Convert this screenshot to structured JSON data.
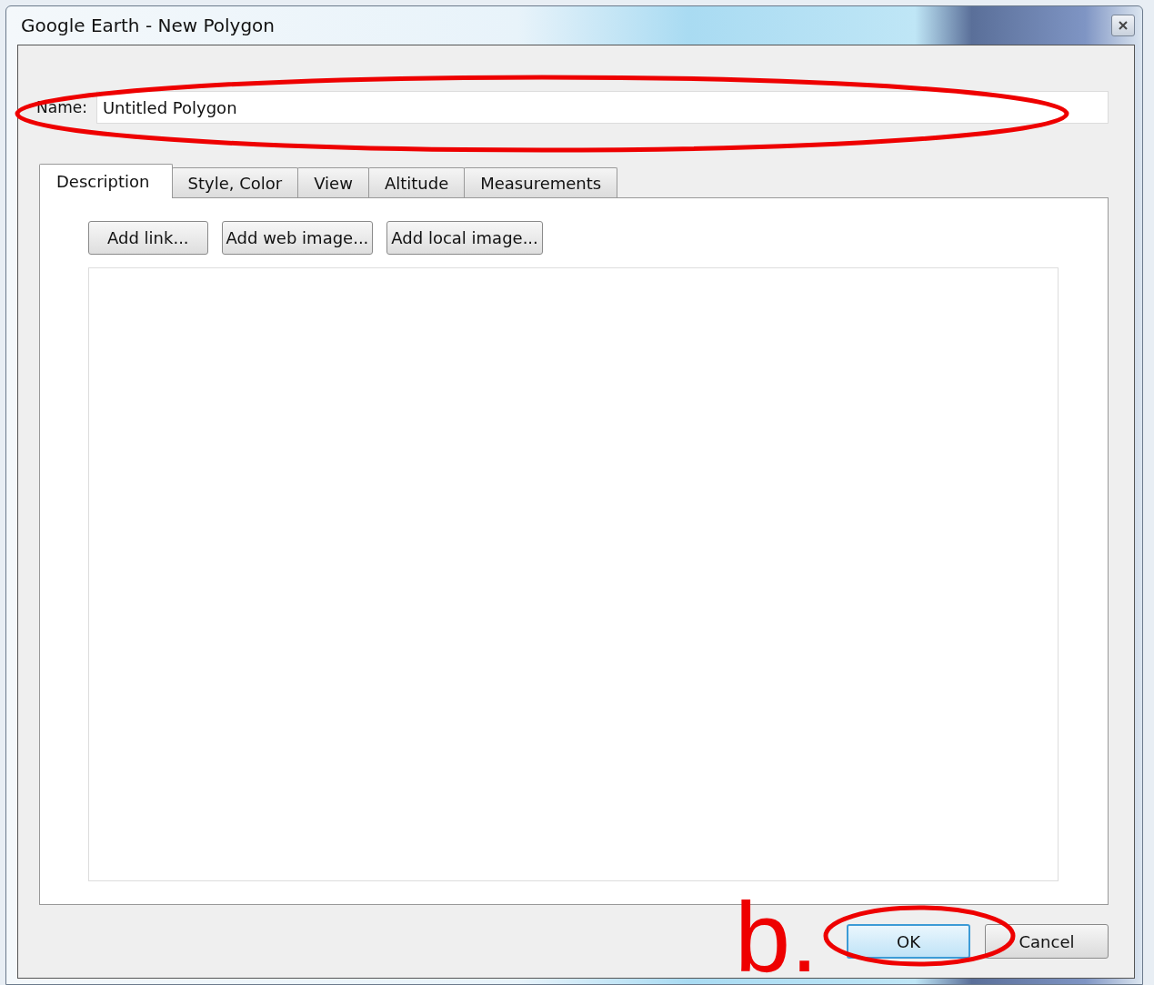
{
  "window": {
    "title": "Google Earth - New Polygon"
  },
  "name_field": {
    "label": "Name:",
    "value": "Untitled Polygon"
  },
  "tabs": [
    {
      "label": "Description",
      "selected": true
    },
    {
      "label": "Style, Color",
      "selected": false
    },
    {
      "label": "View",
      "selected": false
    },
    {
      "label": "Altitude",
      "selected": false
    },
    {
      "label": "Measurements",
      "selected": false
    }
  ],
  "description_buttons": [
    "Add link...",
    "Add web image...",
    "Add local image..."
  ],
  "buttons": [
    {
      "label": "OK",
      "kind": "default"
    },
    {
      "label": "Cancel",
      "kind": "normal"
    }
  ],
  "annotation_label": "b."
}
